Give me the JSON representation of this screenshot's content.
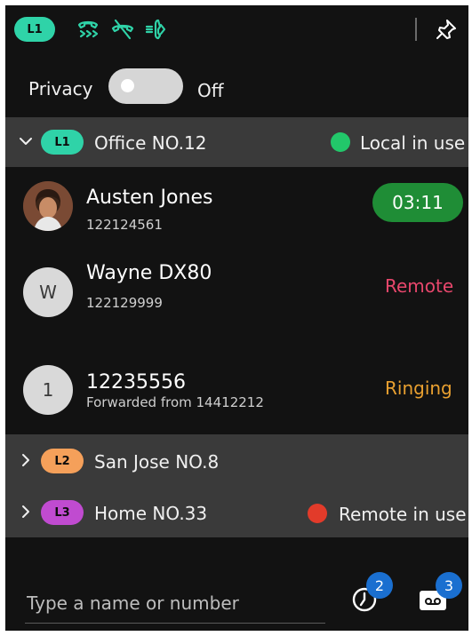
{
  "topbar": {
    "line_label": "L1"
  },
  "privacy": {
    "label": "Privacy",
    "state": "Off",
    "enabled": false
  },
  "lines": [
    {
      "label": "L1",
      "name": "Office NO.12",
      "status": "Local in use",
      "color": "#2fd3a8",
      "status_color": "#22c76a",
      "expanded": true
    },
    {
      "label": "L2",
      "name": "San Jose NO.8",
      "status": "",
      "color": "#f5a05a",
      "expanded": false
    },
    {
      "label": "L3",
      "name": "Home NO.33",
      "status": "Remote in use",
      "color": "#c04bd0",
      "status_color": "#e23b2a",
      "expanded": false
    }
  ],
  "calls": [
    {
      "name": "Austen Jones",
      "number": "122124561",
      "timer": "03:11",
      "avatar": "photo"
    },
    {
      "name": "Wayne DX80",
      "number": "122129999",
      "status": "Remote",
      "status_color": "#e8476c",
      "avatar_initial": "W"
    },
    {
      "name": "12235556",
      "subtext": "Forwarded from 14412212",
      "status": "Ringing",
      "status_color": "#e9a030",
      "avatar_initial": "1"
    }
  ],
  "search": {
    "placeholder": "Type a name or number"
  },
  "badges": {
    "recents_count": "2",
    "voicemail_count": "3"
  }
}
